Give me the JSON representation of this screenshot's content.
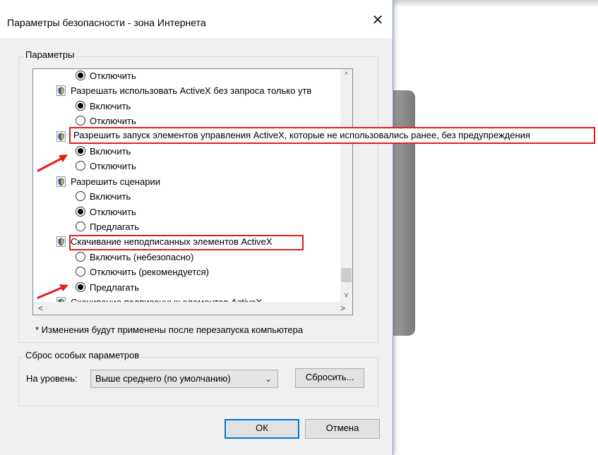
{
  "dialog": {
    "title": "Параметры безопасности - зона Интернета",
    "close": "✕"
  },
  "params": {
    "legend": "Параметры",
    "rows": [
      {
        "kind": "radio",
        "checked": true,
        "label": "Отключить"
      },
      {
        "kind": "item",
        "label": "Разрешать использовать ActiveX без запроса только утв"
      },
      {
        "kind": "radio",
        "checked": true,
        "label": "Включить"
      },
      {
        "kind": "radio",
        "checked": false,
        "label": "Отключить"
      },
      {
        "kind": "item",
        "label": "Разрешить запуск элементов управления ActiveX, которые не использовались ранее, без предупреждения"
      },
      {
        "kind": "radio",
        "checked": true,
        "label": "Включить"
      },
      {
        "kind": "radio",
        "checked": false,
        "label": "Отключить"
      },
      {
        "kind": "item",
        "label": "Разрешить сценарии"
      },
      {
        "kind": "radio",
        "checked": false,
        "label": "Включить"
      },
      {
        "kind": "radio",
        "checked": true,
        "label": "Отключить"
      },
      {
        "kind": "radio",
        "checked": false,
        "label": "Предлагать"
      },
      {
        "kind": "item",
        "label": "Скачивание неподписанных элементов ActiveX"
      },
      {
        "kind": "radio",
        "checked": false,
        "label": "Включить (небезопасно)"
      },
      {
        "kind": "radio",
        "checked": false,
        "label": "Отключить (рекомендуется)"
      },
      {
        "kind": "radio",
        "checked": true,
        "label": "Предлагать"
      },
      {
        "kind": "item",
        "label": "Скачивание подписанных элементов ActiveX"
      }
    ],
    "scroll_up": "^",
    "scroll_down": "v",
    "scroll_left": "<",
    "scroll_right": ">"
  },
  "note": "* Изменения будут применены после перезапуска компьютера",
  "reset": {
    "legend": "Сброс особых параметров",
    "level_label": "На уровень:",
    "level_value": "Выше среднего (по умолчанию)",
    "reset_button": "Сбросить..."
  },
  "buttons": {
    "ok": "ОК",
    "cancel": "Отмена"
  },
  "highlight_color": "#e31d1d",
  "accent_color": "#0078d7"
}
